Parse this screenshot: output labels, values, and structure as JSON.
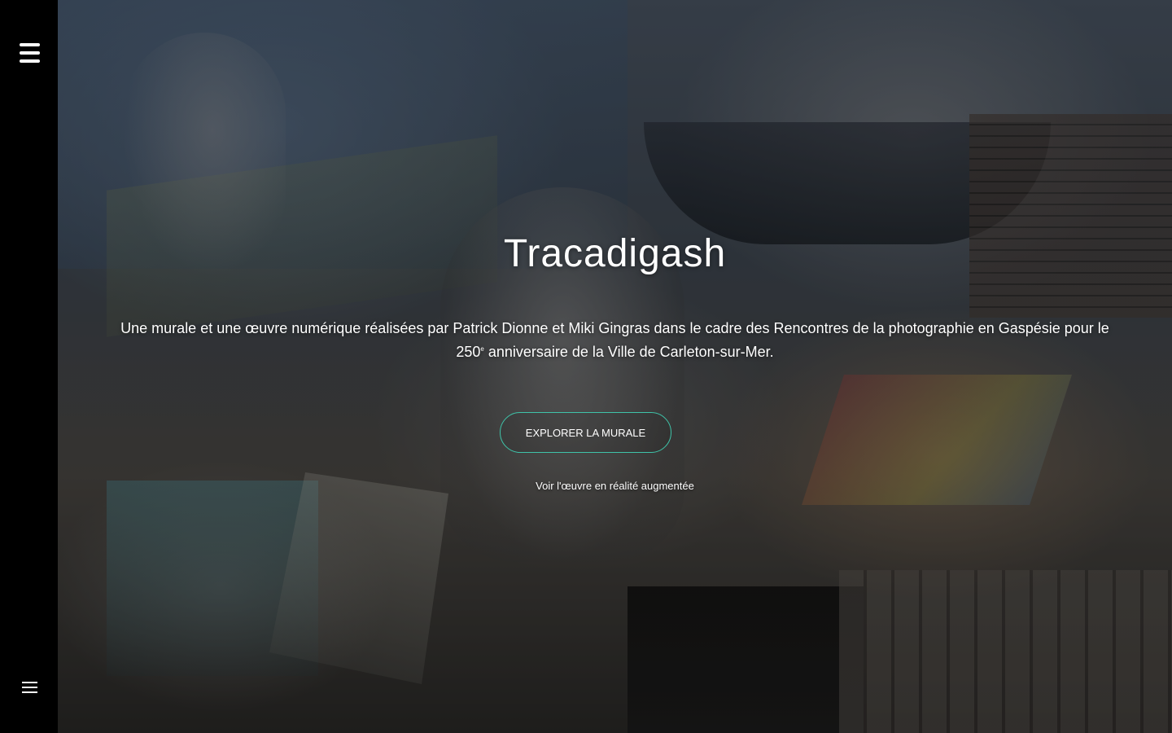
{
  "sidebar": {
    "menu_icon_top": "hamburger-menu-icon",
    "menu_icon_bottom": "hamburger-menu-icon"
  },
  "hero": {
    "title": "Tracadigash",
    "subtitle_part1": "Une murale et une œuvre numérique réalisées par Patrick Dionne et Miki Gingras dans le cadre des Rencontres de la photographie en Gaspésie pour le 250",
    "subtitle_sup": "e",
    "subtitle_part2": " anniversaire de la Ville de Carleton-sur-Mer.",
    "explore_button_label": "Explorer la murale",
    "ar_link_label": "Voir l'œuvre en réalité augmentée"
  },
  "colors": {
    "sidebar_bg": "#000000",
    "button_border": "#3fc3a9",
    "text": "#ffffff"
  }
}
